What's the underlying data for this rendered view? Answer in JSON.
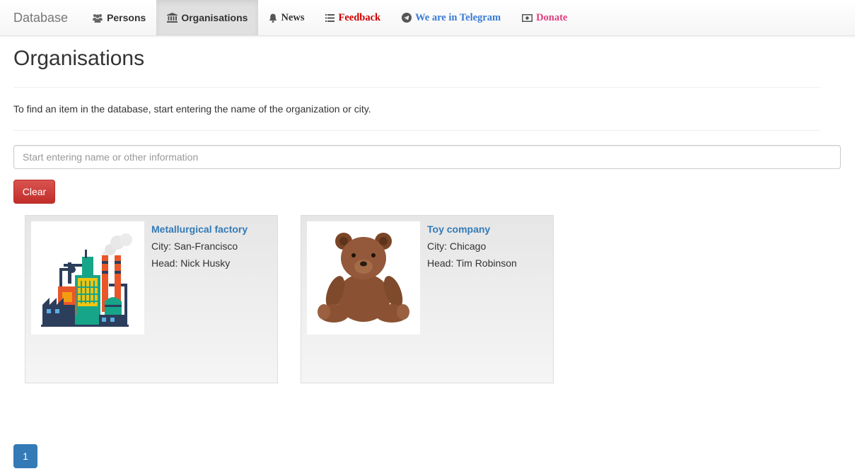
{
  "nav": {
    "brand": "Database",
    "items": [
      {
        "label": "Persons",
        "icon": "users-icon",
        "active": false
      },
      {
        "label": "Organisations",
        "icon": "bank-icon",
        "active": true
      },
      {
        "label": "News",
        "icon": "bell-icon",
        "active": false
      },
      {
        "label": "Feedback",
        "icon": "list-icon",
        "active": false,
        "color": "#cc0000"
      },
      {
        "label": "We are in Telegram",
        "icon": "telegram-icon",
        "active": false,
        "color": "#3a7bd5"
      },
      {
        "label": "Donate",
        "icon": "money-icon",
        "active": false,
        "color": "#e0407f"
      }
    ]
  },
  "page": {
    "title": "Organisations",
    "hint": "To find an item in the database, start entering the name of the organization or city."
  },
  "search": {
    "placeholder": "Start entering name or other information",
    "value": ""
  },
  "clear_label": "Clear",
  "organisations": [
    {
      "name": "Metallurgical factory",
      "city": "City: San-Francisco",
      "head": "Head: Nick Husky",
      "image": "factory-illustration"
    },
    {
      "name": "Toy company",
      "city": "City: Chicago",
      "head": "Head: Tim Robinson",
      "image": "teddy-bear-photo"
    }
  ],
  "pagination": {
    "current": "1"
  },
  "colors": {
    "primary": "#337ab7",
    "danger": "#d9534f",
    "feedback": "#cc0000",
    "telegram": "#3a7bd5",
    "donate": "#e0407f"
  }
}
